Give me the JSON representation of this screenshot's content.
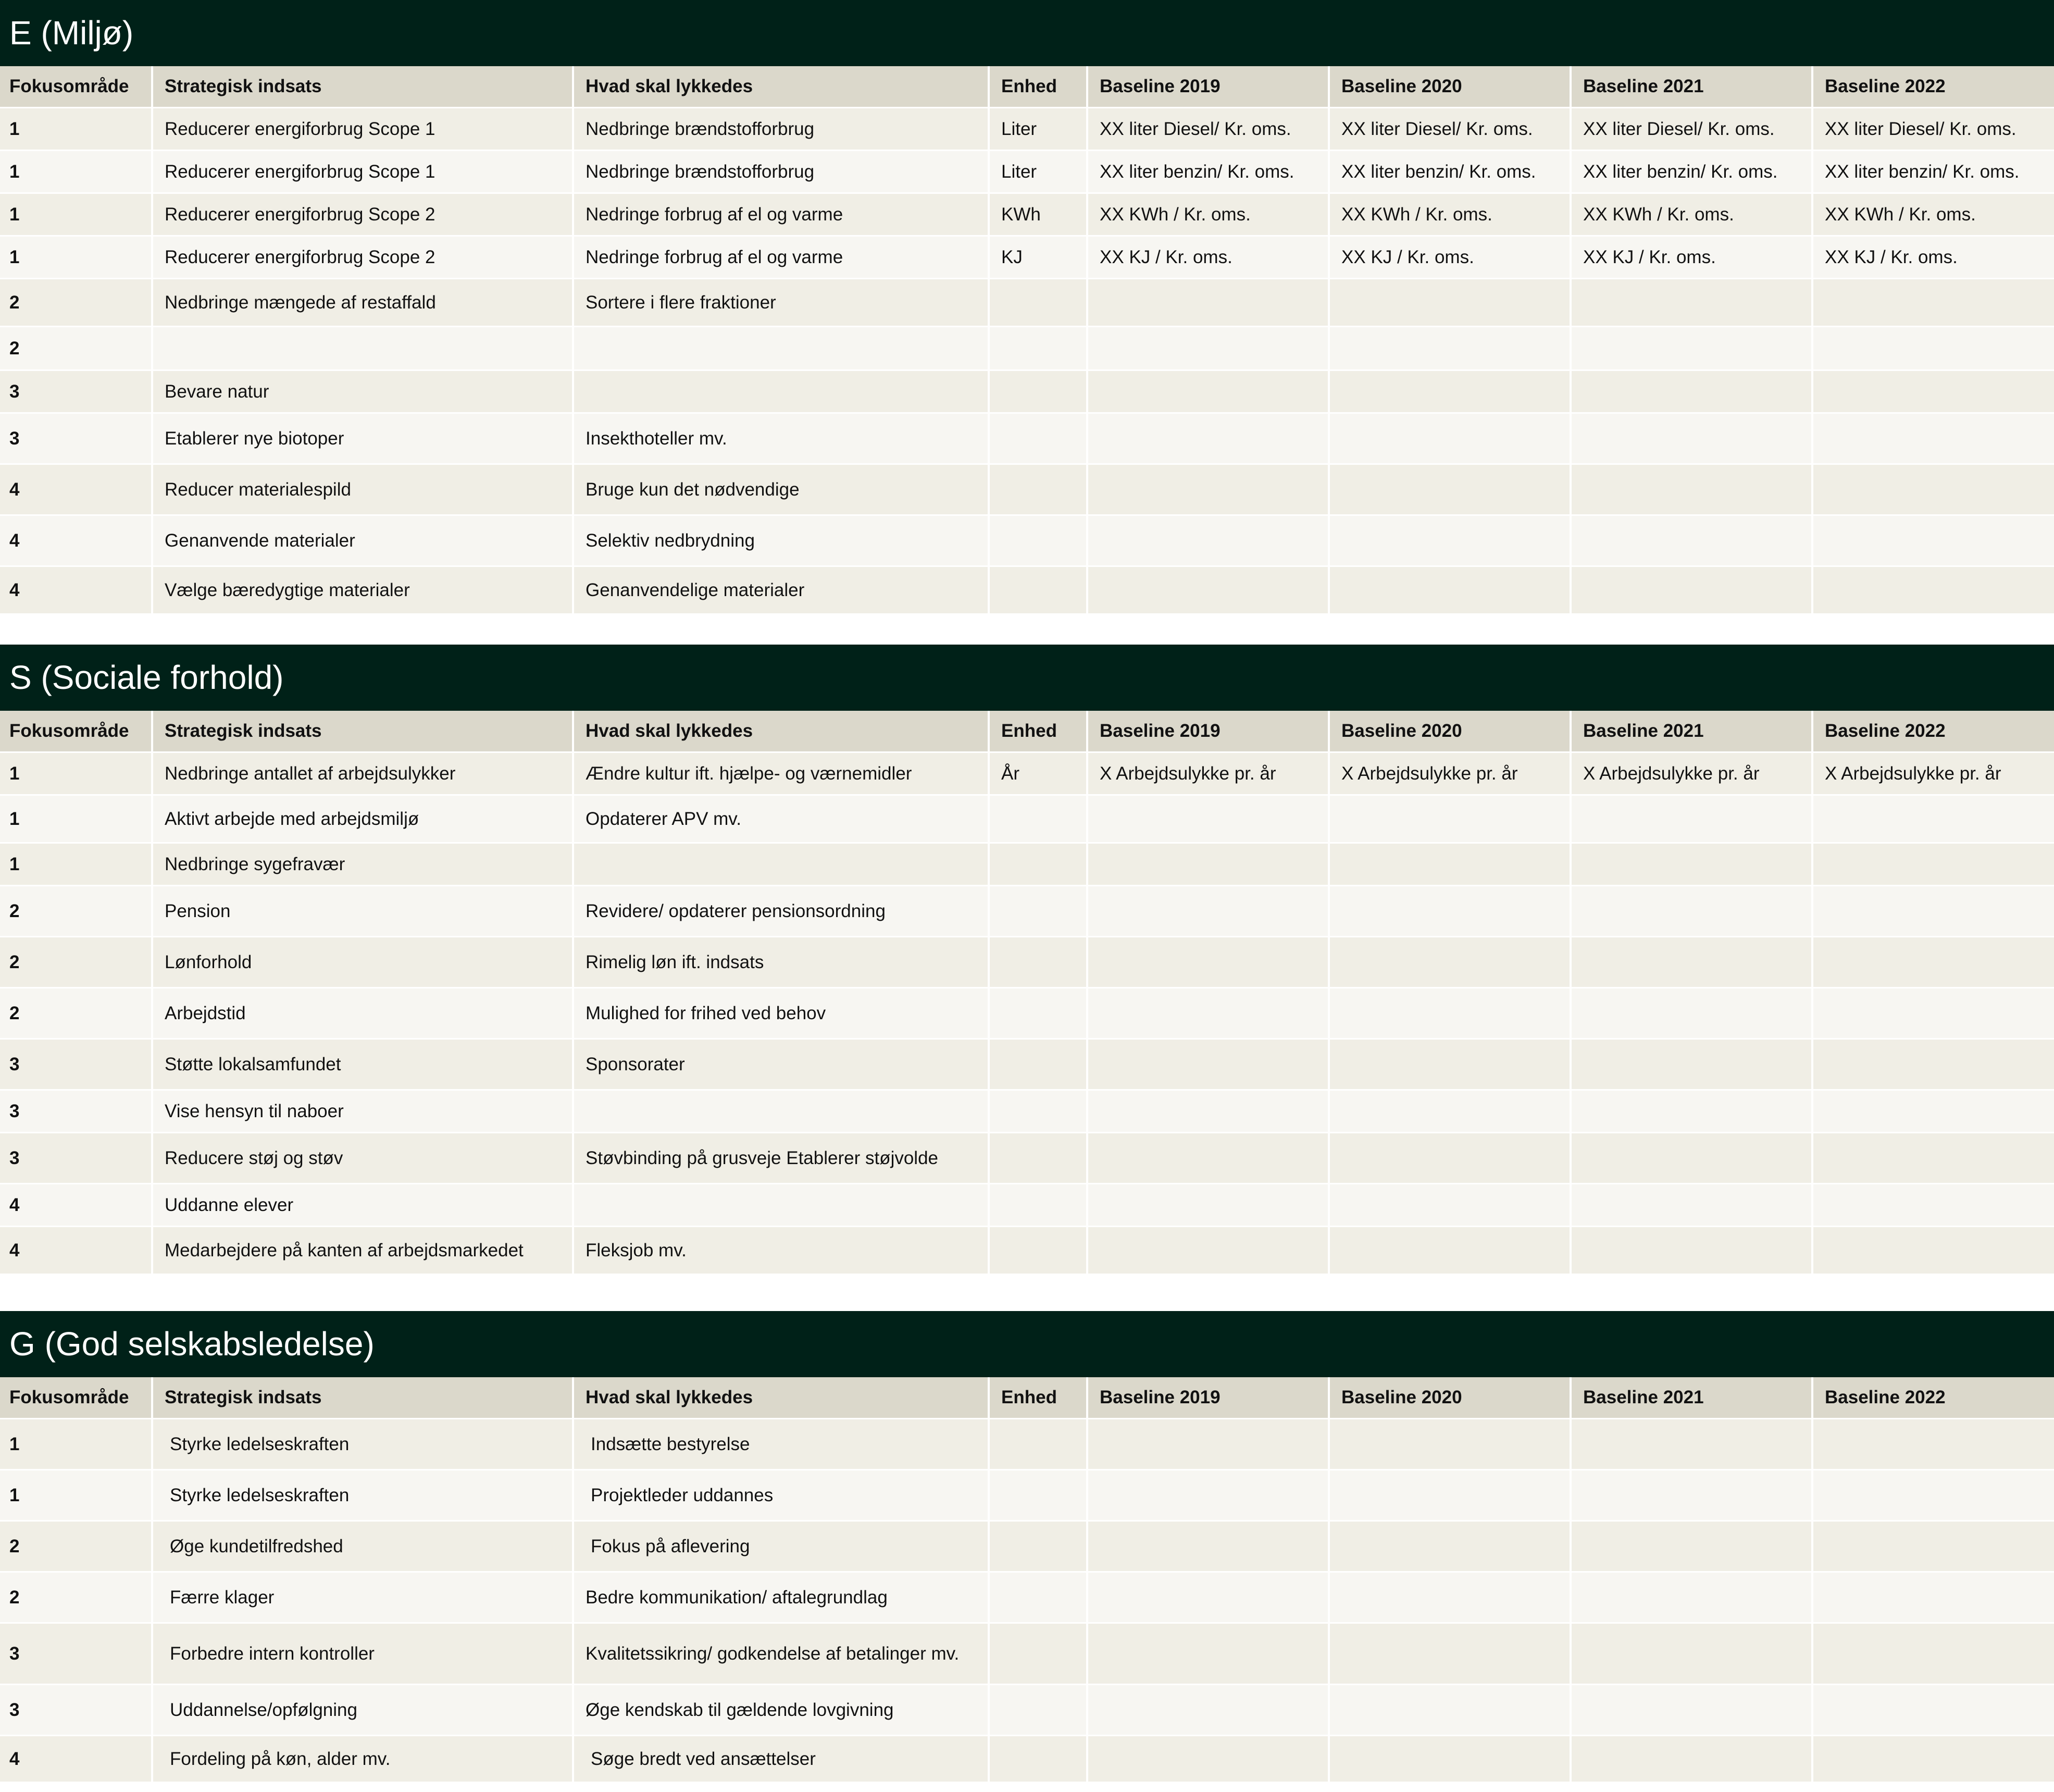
{
  "headers": [
    "Fokusområde",
    "Strategisk indsats",
    "Hvad skal lykkedes",
    "Enhed",
    "Baseline 2019",
    "Baseline 2020",
    "Baseline 2021",
    "Baseline 2022"
  ],
  "sections": [
    {
      "title": "E (Miljø)",
      "rows": [
        [
          "1",
          "Reducerer energiforbrug Scope 1",
          "Nedbringe brændstofforbrug",
          "Liter",
          "XX liter Diesel/ Kr. oms.",
          "XX liter Diesel/ Kr. oms.",
          "XX liter Diesel/ Kr. oms.",
          "XX liter Diesel/ Kr. oms."
        ],
        [
          "1",
          "Reducerer energiforbrug Scope 1",
          "Nedbringe brændstofforbrug",
          "Liter",
          "XX liter benzin/ Kr. oms.",
          "XX liter benzin/ Kr. oms.",
          "XX liter benzin/ Kr. oms.",
          "XX liter benzin/ Kr. oms."
        ],
        [
          "1",
          "Reducerer energiforbrug Scope 2",
          "Nedringe forbrug af el og varme",
          "KWh",
          "XX KWh / Kr. oms.",
          "XX KWh / Kr. oms.",
          "XX KWh / Kr. oms.",
          "XX KWh / Kr. oms."
        ],
        [
          "1",
          "Reducerer energiforbrug Scope 2",
          "Nedringe forbrug af el og varme",
          "KJ",
          "XX KJ / Kr. oms.",
          "XX KJ / Kr. oms.",
          "XX KJ / Kr. oms.",
          "XX KJ / Kr. oms."
        ],
        [
          "2",
          "Nedbringe mængede af restaffald",
          "Sortere i flere fraktioner",
          "",
          "",
          "",
          "",
          ""
        ],
        [
          "2",
          "",
          "",
          "",
          "",
          "",
          "",
          ""
        ],
        [
          "3",
          "Bevare natur",
          "",
          "",
          "",
          "",
          "",
          ""
        ],
        [
          "3",
          "Etablerer nye biotoper",
          "Insekthoteller mv.",
          "",
          "",
          "",
          "",
          ""
        ],
        [
          "4",
          "Reducer materialespild",
          "Bruge kun det nødvendige",
          "",
          "",
          "",
          "",
          ""
        ],
        [
          "4",
          "Genanvende materialer",
          "Selektiv nedbrydning",
          "",
          "",
          "",
          "",
          ""
        ],
        [
          "4",
          "Vælge bæredygtige materialer",
          "Genanvendelige materialer",
          "",
          "",
          "",
          "",
          ""
        ]
      ]
    },
    {
      "title": "S (Sociale forhold)",
      "rows": [
        [
          "1",
          "Nedbringe antallet af arbejdsulykker",
          "Ændre kultur ift. hjælpe- og værnemidler",
          "År",
          "X Arbejdsulykke pr. år",
          "X Arbejdsulykke pr. år",
          "X Arbejdsulykke pr. år",
          "X Arbejdsulykke pr. år"
        ],
        [
          "1",
          "Aktivt arbejde med arbejdsmiljø",
          "Opdaterer APV mv.",
          "",
          "",
          "",
          "",
          ""
        ],
        [
          "1",
          "Nedbringe sygefravær",
          "",
          "",
          "",
          "",
          "",
          ""
        ],
        [
          "2",
          "Pension",
          "Revidere/ opdaterer pensionsordning",
          "",
          "",
          "",
          "",
          ""
        ],
        [
          "2",
          "Lønforhold",
          "Rimelig løn ift. indsats",
          "",
          "",
          "",
          "",
          ""
        ],
        [
          "2",
          "Arbejdstid",
          "Mulighed for frihed ved behov",
          "",
          "",
          "",
          "",
          ""
        ],
        [
          "3",
          "Støtte lokalsamfundet",
          "Sponsorater",
          "",
          "",
          "",
          "",
          ""
        ],
        [
          "3",
          "Vise hensyn til naboer",
          "",
          "",
          "",
          "",
          "",
          ""
        ],
        [
          "3",
          "Reducere støj og støv",
          "Støvbinding på grusveje Etablerer støjvolde",
          "",
          "",
          "",
          "",
          ""
        ],
        [
          "4",
          "Uddanne elever",
          "",
          "",
          "",
          "",
          "",
          ""
        ],
        [
          "4",
          "Medarbejdere på kanten af arbejdsmarkedet",
          "Fleksjob mv.",
          "",
          "",
          "",
          "",
          ""
        ]
      ]
    },
    {
      "title": "G (God selskabsledelse)",
      "rows": [
        [
          "1",
          "Styrke ledelseskraften",
          "Indsætte bestyrelse",
          "",
          "",
          "",
          "",
          ""
        ],
        [
          "1",
          "Styrke ledelseskraften",
          "Projektleder uddannes",
          "",
          "",
          "",
          "",
          ""
        ],
        [
          "2",
          "Øge kundetilfredshed",
          "Fokus på aflevering",
          "",
          "",
          "",
          "",
          ""
        ],
        [
          "2",
          "Færre klager",
          "Bedre kommunikation/ aftalegrundlag",
          "",
          "",
          "",
          "",
          ""
        ],
        [
          "3",
          "Forbedre intern kontroller",
          "Kvalitetssikring/ godkendelse af betalinger mv.",
          "",
          "",
          "",
          "",
          ""
        ],
        [
          "3",
          "Uddannelse/opfølgning",
          "Øge kendskab til gældende lovgivning",
          "",
          "",
          "",
          "",
          ""
        ],
        [
          "4",
          "Fordeling på køn, alder mv.",
          "Søge bredt ved ansættelser",
          "",
          "",
          "",
          "",
          ""
        ]
      ]
    }
  ]
}
